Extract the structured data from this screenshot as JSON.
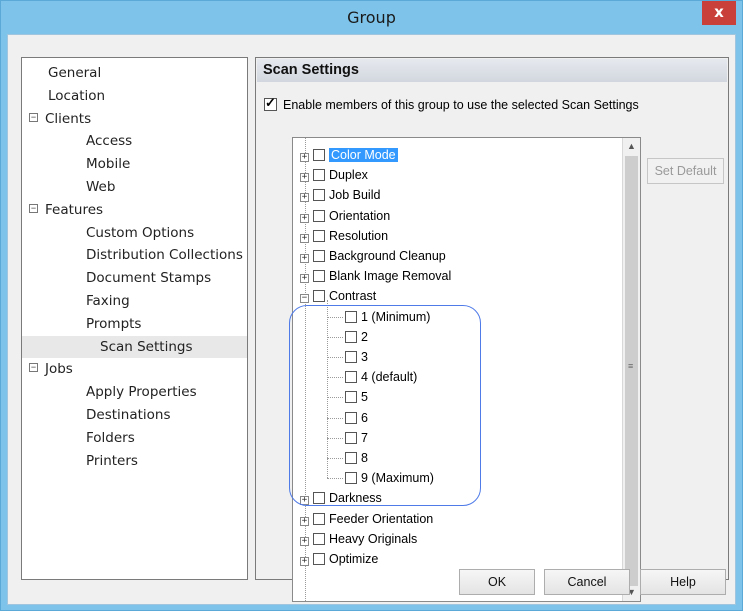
{
  "window": {
    "title": "Group",
    "close_label": "x"
  },
  "nav": {
    "items": [
      {
        "label": "General",
        "level": 0
      },
      {
        "label": "Location",
        "level": 0
      },
      {
        "label": "Clients",
        "level": 0,
        "toggle": "−"
      },
      {
        "label": "Access",
        "level": 1
      },
      {
        "label": "Mobile",
        "level": 1
      },
      {
        "label": "Web",
        "level": 1
      },
      {
        "label": "Features",
        "level": 0,
        "toggle": "−"
      },
      {
        "label": "Custom Options",
        "level": 1
      },
      {
        "label": "Distribution Collections",
        "level": 1
      },
      {
        "label": "Document Stamps",
        "level": 1
      },
      {
        "label": "Faxing",
        "level": 1
      },
      {
        "label": "Prompts",
        "level": 1
      },
      {
        "label": "Scan Settings",
        "level": 1,
        "selected": true
      },
      {
        "label": "Jobs",
        "level": 0,
        "toggle": "−"
      },
      {
        "label": "Apply Properties",
        "level": 1
      },
      {
        "label": "Destinations",
        "level": 1
      },
      {
        "label": "Folders",
        "level": 1
      },
      {
        "label": "Printers",
        "level": 1
      }
    ]
  },
  "panel": {
    "title": "Scan Settings",
    "enable_label": "Enable members of this group to use the selected Scan Settings",
    "enable_checked": true,
    "set_default_label": "Set Default"
  },
  "tree": {
    "top_items": [
      "Color Mode",
      "Duplex",
      "Job Build",
      "Orientation",
      "Resolution",
      "Background Cleanup",
      "Blank Image Removal"
    ],
    "expanded_item": "Contrast",
    "contrast_options": [
      "1 (Minimum)",
      "2",
      "3",
      "4 (default)",
      "5",
      "6",
      "7",
      "8",
      "9 (Maximum)"
    ],
    "bottom_items": [
      "Darkness",
      "Feeder Orientation",
      "Heavy Originals",
      "Optimize"
    ],
    "selected_item": "Color Mode"
  },
  "buttons": {
    "ok": "OK",
    "cancel": "Cancel",
    "help": "Help"
  },
  "colors": {
    "titlebar": "#7ec4ea",
    "close": "#c9403a",
    "selection": "#3399ff",
    "highlight_ring": "#4f7be8"
  }
}
